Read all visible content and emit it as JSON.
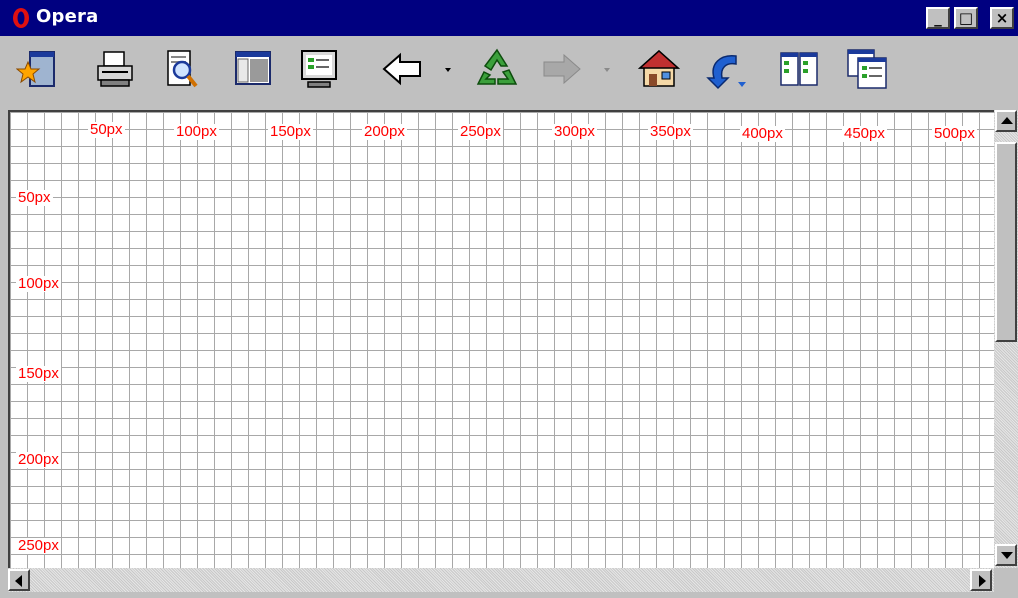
{
  "window": {
    "title": "Opera",
    "logo_icon": "opera-logo-icon",
    "controls": {
      "minimize_glyph": "_",
      "maximize_glyph": "□",
      "close_glyph": "×"
    }
  },
  "toolbar": {
    "buttons": [
      {
        "name": "hotlist-button",
        "icon": "hotlist-star-icon"
      },
      {
        "name": "print-button",
        "icon": "printer-icon"
      },
      {
        "name": "find-button",
        "icon": "find-magnifier-icon"
      },
      {
        "name": "panels-button",
        "icon": "window-panels-icon"
      },
      {
        "name": "fullscreen-button",
        "icon": "monitor-icon"
      },
      {
        "name": "back-button",
        "icon": "back-arrow-icon",
        "has_dropdown": true
      },
      {
        "name": "reload-button",
        "icon": "reload-recycle-icon"
      },
      {
        "name": "forward-button",
        "icon": "forward-arrow-icon",
        "has_dropdown": true,
        "disabled": true
      },
      {
        "name": "home-button",
        "icon": "home-icon"
      },
      {
        "name": "go-button",
        "icon": "go-arrow-icon"
      },
      {
        "name": "tile-button",
        "icon": "tile-windows-icon"
      },
      {
        "name": "cascade-button",
        "icon": "cascade-windows-icon"
      }
    ]
  },
  "page": {
    "grid_color": "#a8a8a8",
    "label_color": "#ff0000",
    "top_ruler": [
      "50px",
      "100px",
      "150px",
      "200px",
      "250px",
      "300px",
      "350px",
      "400px",
      "450px",
      "500px"
    ],
    "left_ruler": [
      "50px",
      "100px",
      "150px",
      "200px",
      "250px"
    ]
  },
  "colors": {
    "titlebar": "#000080",
    "chrome": "#c0c0c0"
  }
}
